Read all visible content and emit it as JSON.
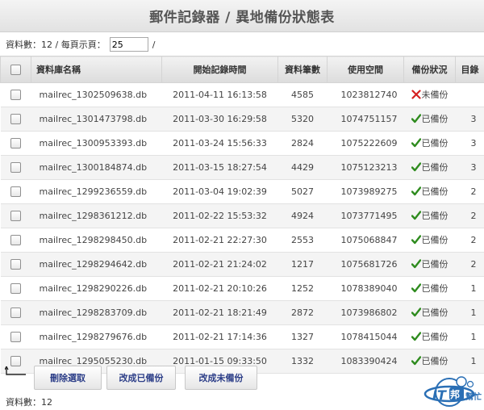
{
  "title": "郵件記錄器 / 異地備份狀態表",
  "info": {
    "prefix": "資料數：12 / 每頁示頁：",
    "page_size": "25",
    "suffix": "/"
  },
  "columns": {
    "db_name": "資料庫名稱",
    "start_time": "開始記錄時間",
    "record_count": "資料筆數",
    "space_used": "使用空間",
    "backup_status": "備份狀況",
    "directory": "目錄"
  },
  "rows": [
    {
      "name": "mailrec_1302509638.db",
      "start": "2011-04-11 16:13:58",
      "count": "4585",
      "space": "1023812740",
      "status": "未備份",
      "backed_up": false,
      "dir": ""
    },
    {
      "name": "mailrec_1301473798.db",
      "start": "2011-03-30 16:29:58",
      "count": "5320",
      "space": "1074751157",
      "status": "已備份",
      "backed_up": true,
      "dir": "3"
    },
    {
      "name": "mailrec_1300953393.db",
      "start": "2011-03-24 15:56:33",
      "count": "2824",
      "space": "1075222609",
      "status": "已備份",
      "backed_up": true,
      "dir": "3"
    },
    {
      "name": "mailrec_1300184874.db",
      "start": "2011-03-15 18:27:54",
      "count": "4429",
      "space": "1075123213",
      "status": "已備份",
      "backed_up": true,
      "dir": "3"
    },
    {
      "name": "mailrec_1299236559.db",
      "start": "2011-03-04 19:02:39",
      "count": "5027",
      "space": "1073989275",
      "status": "已備份",
      "backed_up": true,
      "dir": "2"
    },
    {
      "name": "mailrec_1298361212.db",
      "start": "2011-02-22 15:53:32",
      "count": "4924",
      "space": "1073771495",
      "status": "已備份",
      "backed_up": true,
      "dir": "2"
    },
    {
      "name": "mailrec_1298298450.db",
      "start": "2011-02-21 22:27:30",
      "count": "2553",
      "space": "1075068847",
      "status": "已備份",
      "backed_up": true,
      "dir": "2"
    },
    {
      "name": "mailrec_1298294642.db",
      "start": "2011-02-21 21:24:02",
      "count": "1217",
      "space": "1075681726",
      "status": "已備份",
      "backed_up": true,
      "dir": "2"
    },
    {
      "name": "mailrec_1298290226.db",
      "start": "2011-02-21 20:10:26",
      "count": "1252",
      "space": "1078389040",
      "status": "已備份",
      "backed_up": true,
      "dir": "1"
    },
    {
      "name": "mailrec_1298283709.db",
      "start": "2011-02-21 18:21:49",
      "count": "2872",
      "space": "1073986802",
      "status": "已備份",
      "backed_up": true,
      "dir": "1"
    },
    {
      "name": "mailrec_1298279676.db",
      "start": "2011-02-21 17:14:36",
      "count": "1327",
      "space": "1078415044",
      "status": "已備份",
      "backed_up": true,
      "dir": "1"
    },
    {
      "name": "mailrec_1295055230.db",
      "start": "2011-01-15 09:33:50",
      "count": "1332",
      "space": "1083390424",
      "status": "已備份",
      "backed_up": true,
      "dir": "1"
    }
  ],
  "actions": {
    "delete": "刪除選取",
    "mark_backed_up": "改成已備份",
    "mark_not_backed_up": "改成未備份"
  },
  "footer": {
    "count_text": "資料數：12"
  },
  "logo": {
    "text": "IT邦",
    "subtext": "幫忙"
  },
  "icons": {
    "backed_up": "check-icon",
    "not_backed_up": "cross-icon",
    "return": "return-arrow-icon"
  },
  "colors": {
    "check": "#2e8b1e",
    "cross": "#d42020",
    "button_text": "#2c3e88",
    "logo": "#2a6fb5"
  }
}
